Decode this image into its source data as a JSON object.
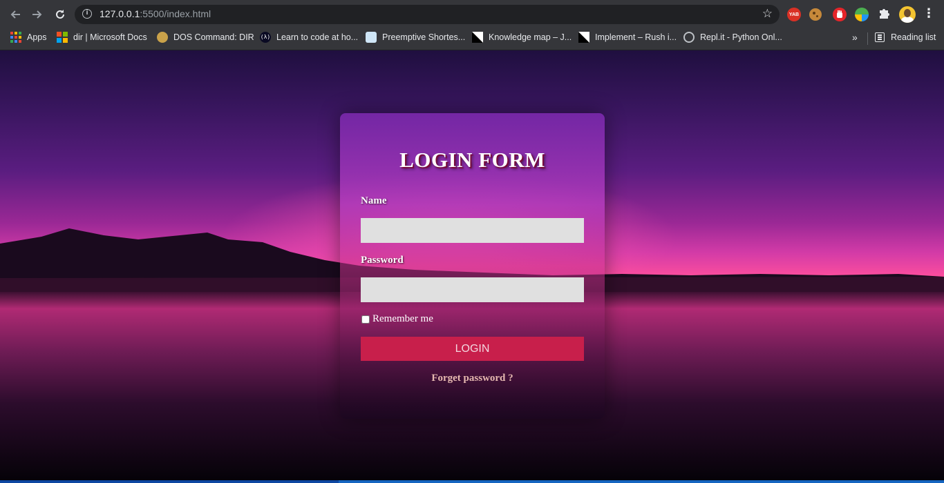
{
  "browser": {
    "url_host": "127.0.0.1",
    "url_rest": ":5500/index.html",
    "bookmarks": [
      {
        "label": "Apps",
        "icon": "apps-grid-icon"
      },
      {
        "label": "dir | Microsoft Docs",
        "icon": "microsoft-icon"
      },
      {
        "label": "DOS Command: DIR",
        "icon": "dos-icon"
      },
      {
        "label": "Learn to code at ho...",
        "icon": "freecodecamp-icon"
      },
      {
        "label": "Preemptive Shortes...",
        "icon": "preemptive-icon"
      },
      {
        "label": "Knowledge map – J...",
        "icon": "knowledge-map-icon"
      },
      {
        "label": "Implement – Rush i...",
        "icon": "implement-icon"
      },
      {
        "label": "Repl.it - Python Onl...",
        "icon": "replit-icon"
      }
    ],
    "bookmarks_more": "»",
    "reading_list": "Reading list",
    "extensions": {
      "yab_label": "YAB"
    }
  },
  "form": {
    "title": "LOGIN FORM",
    "name_label": "Name",
    "name_value": "",
    "password_label": "Password",
    "password_value": "",
    "remember_label": "Remember me",
    "remember_checked": false,
    "login_button": "LOGIN",
    "forget_link": "Forget password ?"
  },
  "colors": {
    "chrome_bg": "#35363a",
    "login_button": "#c81f4b",
    "field_bg": "#e0e0e0"
  }
}
